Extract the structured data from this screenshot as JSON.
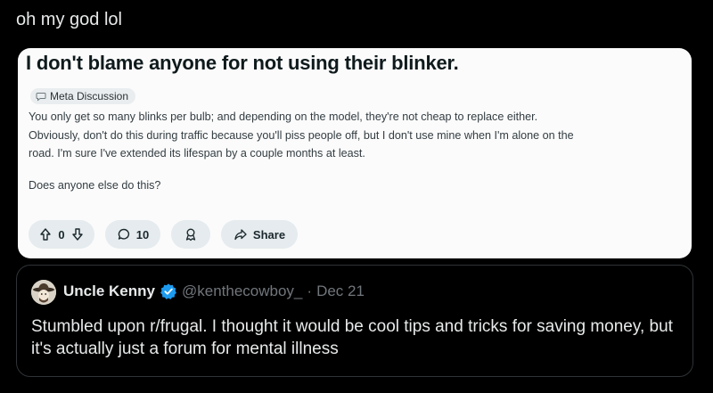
{
  "tweet": {
    "text": "oh my god lol"
  },
  "reddit_post": {
    "title": "I don't blame anyone for not using their blinker.",
    "flair": "Meta Discussion",
    "body_lines": [
      "You only get so many blinks per bulb; and depending on the model, they're not cheap to replace either.",
      "Obviously, don't do this during traffic because you'll piss people off, but I don't use mine when I'm alone on the",
      "road. I'm sure I've extended its lifespan by a couple months at least.",
      "Does anyone else do this?"
    ],
    "actions": {
      "vote_count": "0",
      "comment_count": "10",
      "share_label": "Share"
    }
  },
  "quoted_tweet": {
    "author_name": "Uncle Kenny",
    "handle": "@kenthecowboy_",
    "separator": "·",
    "date": "Dec 21",
    "text": "Stumbled upon r/frugal. I thought it would be cool tips and tricks for saving money, but it's actually just a forum for mental illness"
  },
  "colors": {
    "background": "#000000",
    "verified_badge": "#1d9bf0",
    "card_background": "#fbfbfb",
    "muted_text": "#71767b"
  }
}
